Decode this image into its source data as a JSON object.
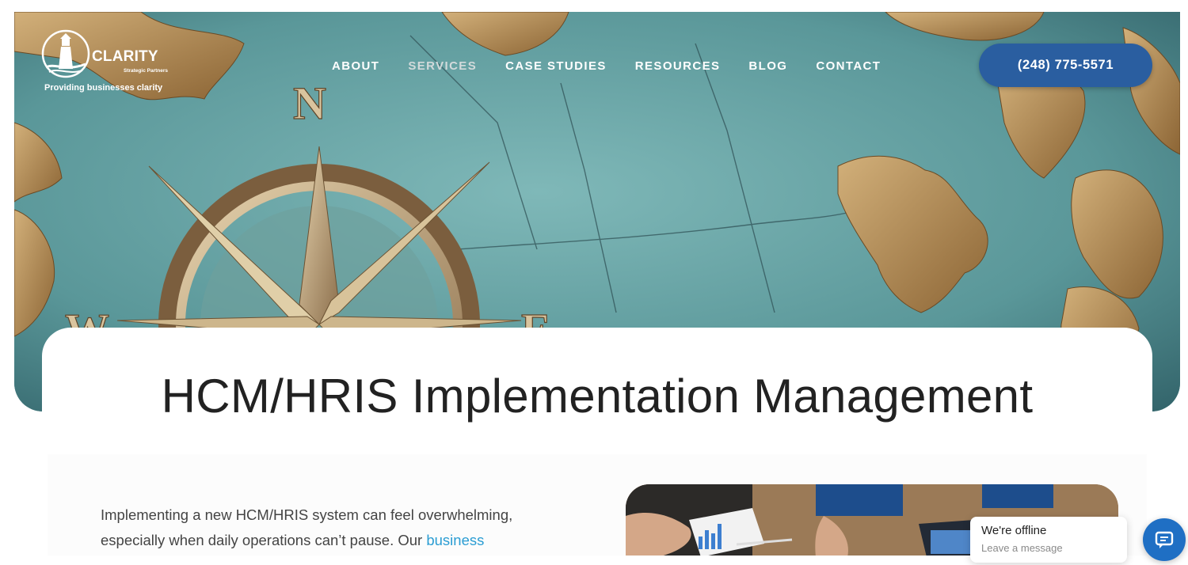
{
  "header": {
    "logo": {
      "name": "CLARITY",
      "subtitle": "Strategic Partners",
      "tagline": "Providing businesses clarity"
    },
    "nav": [
      {
        "label": "ABOUT"
      },
      {
        "label": "SERVICES"
      },
      {
        "label": "CASE STUDIES"
      },
      {
        "label": "RESOURCES"
      },
      {
        "label": "BLOG"
      },
      {
        "label": "CONTACT"
      }
    ],
    "active_nav": "SERVICES",
    "phone": "(248) 775-5571"
  },
  "hero": {
    "compass_letters": [
      "N",
      "W",
      "E"
    ]
  },
  "page": {
    "title": "HCM/HRIS Implementation Management"
  },
  "intro": {
    "text_before_link": "Implementing a new HCM/HRIS system can feel overwhelming, especially when daily operations can’t pause. Our ",
    "link_text": "business"
  },
  "chat": {
    "status": "We're offline",
    "prompt": "Leave a message"
  },
  "colors": {
    "primary_button": "#2a5ea0",
    "link": "#2b9dd3",
    "chat_button": "#1f6fc4",
    "map_sea": "#5e9ea0"
  }
}
